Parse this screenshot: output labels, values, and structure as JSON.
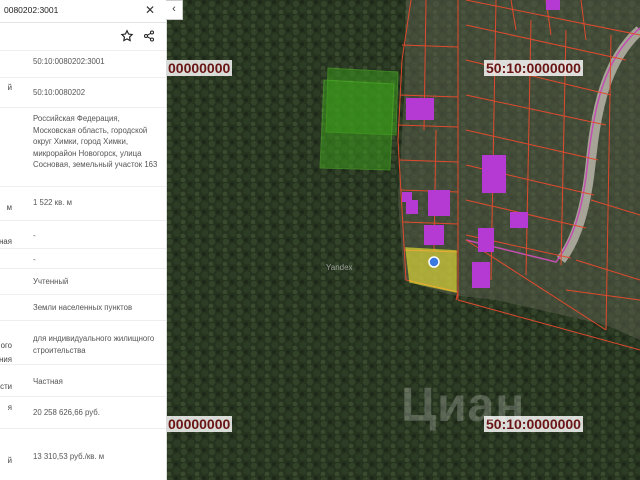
{
  "search": {
    "query": "0080202:3001"
  },
  "panel": {
    "rows": [
      {
        "label": "",
        "value": "50:10:0080202:3001"
      },
      {
        "label": "й",
        "value": "50:10:0080202"
      },
      {
        "label": "",
        "value": "Российская Федерация, Московская область, городской округ Химки, город Химки, микрорайон Новогорск, улица Сосновая, земельный участок 163"
      },
      {
        "label": "м",
        "value": "1 522 кв. м"
      },
      {
        "label": "занная",
        "value": "-"
      },
      {
        "label": "",
        "value": "-"
      },
      {
        "label": "",
        "value": "Учтенный"
      },
      {
        "label": "",
        "value": "Земли населенных пунктов"
      },
      {
        "label": "ого\nания",
        "value": "для индивидуального жилищного строительства"
      },
      {
        "label": "сти",
        "value": "Частная"
      },
      {
        "label": "я",
        "value": "20 258 626,66 руб."
      },
      {
        "label": "й",
        "value": "13 310,53 руб./кв. м"
      }
    ]
  },
  "map": {
    "cadastral_labels": [
      "00000000",
      "50:10:0000000",
      "00000000",
      "50:10:0000000"
    ],
    "yandex": "Yandex",
    "watermark": "Циан",
    "colors": {
      "forest": "#22301f",
      "parcel_line": "#e04a2e",
      "green_parcel": "#3c9a1c",
      "selected_parcel": "#f2ea3a",
      "building": "#b53ad4",
      "road": "#b9b4a8"
    }
  }
}
